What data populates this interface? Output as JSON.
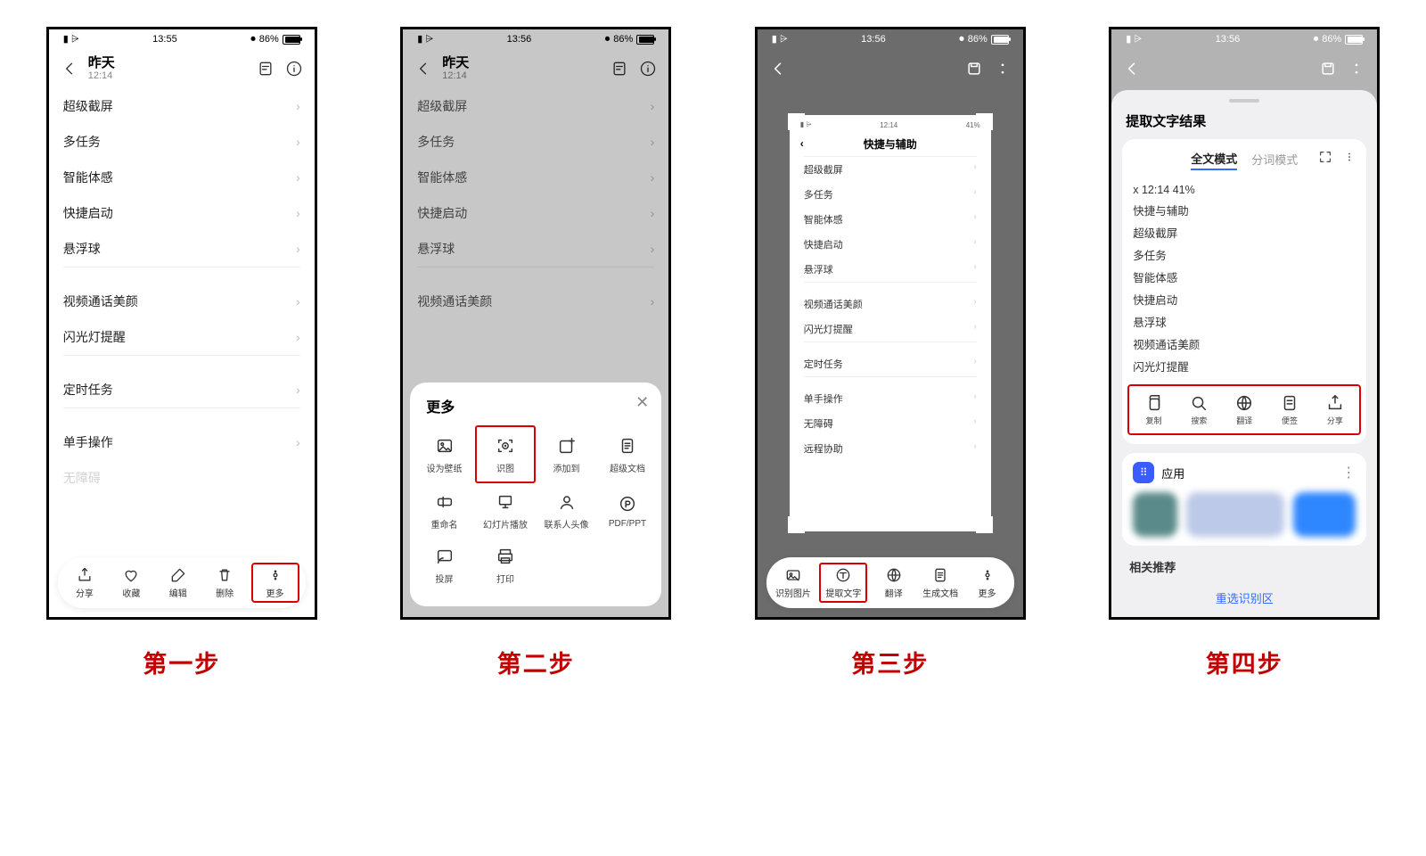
{
  "step_labels": [
    "第一步",
    "第二步",
    "第三步",
    "第四步"
  ],
  "status": {
    "time1": "13:55",
    "time2": "13:56",
    "battery": "86%"
  },
  "header": {
    "day": "昨天",
    "time": "12:14"
  },
  "list": {
    "group1": [
      "超级截屏",
      "多任务",
      "智能体感",
      "快捷启动",
      "悬浮球"
    ],
    "group2": [
      "视频通话美颜",
      "闪光灯提醒"
    ],
    "group3": [
      "定时任务"
    ],
    "group4": [
      "单手操作",
      "无障碍"
    ]
  },
  "toolbar1": [
    "分享",
    "收藏",
    "编辑",
    "删除",
    "更多"
  ],
  "sheet": {
    "title": "更多",
    "row1": [
      "设为壁纸",
      "识图",
      "添加到",
      "超级文档"
    ],
    "row2": [
      "重命名",
      "幻灯片播放",
      "联系人头像",
      "PDF/PPT"
    ],
    "row3": [
      "投屏",
      "打印"
    ]
  },
  "inner": {
    "time": "12:14",
    "bat": "41%",
    "title": "快捷与辅助",
    "g1": [
      "超级截屏",
      "多任务",
      "智能体感",
      "快捷启动",
      "悬浮球"
    ],
    "g2": [
      "视频通话美颜",
      "闪光灯提醒"
    ],
    "g3": [
      "定时任务"
    ],
    "g4": [
      "单手操作",
      "无障碍",
      "远程协助"
    ]
  },
  "toolbar3": [
    "识别图片",
    "提取文字",
    "翻译",
    "生成文档",
    "更多"
  ],
  "panel4": {
    "title": "提取文字结果",
    "tab1": "全文模式",
    "tab2": "分词模式",
    "lines": [
      "x 12:14 41%",
      "快捷与辅助",
      "超级截屏",
      "多任务",
      "智能体感",
      "快捷启动",
      "悬浮球",
      "视频通话美颜",
      "闪光灯提醒"
    ],
    "actions": [
      "复制",
      "搜索",
      "翻译",
      "便签",
      "分享"
    ],
    "app": "应用",
    "rec": "相关推荐",
    "relink": "重选识别区"
  }
}
